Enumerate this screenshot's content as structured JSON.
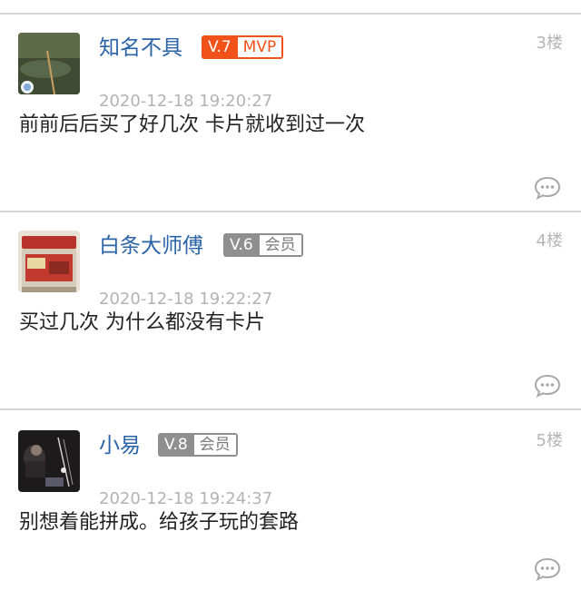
{
  "posts": [
    {
      "username": "知名不具",
      "level": "V.7",
      "tag": "MVP",
      "badge_style": "orange",
      "floor": "3楼",
      "time": "2020-12-18 19:20:27",
      "content": "前前后后买了好几次 卡片就收到过一次",
      "avatar_icon": "avatar-fishing-icon"
    },
    {
      "username": "白条大师傅",
      "level": "V.6",
      "tag": "会员",
      "badge_style": "gray",
      "floor": "4楼",
      "time": "2020-12-18 19:22:27",
      "content": "买过几次 为什么都没有卡片",
      "avatar_icon": "avatar-cooler-box-icon"
    },
    {
      "username": "小易",
      "level": "V.8",
      "tag": "会员",
      "badge_style": "gray",
      "floor": "5楼",
      "time": "2020-12-18 19:24:37",
      "content": "别想着能拼成。给孩子玩的套路",
      "avatar_icon": "avatar-night-fishing-icon"
    }
  ],
  "colors": {
    "username": "#2a63a8",
    "mvp_badge": "#f0521a",
    "member_badge": "#8f8f8f",
    "separator": "#d6d6d6"
  },
  "reply_icon": "comment-bubble-icon"
}
